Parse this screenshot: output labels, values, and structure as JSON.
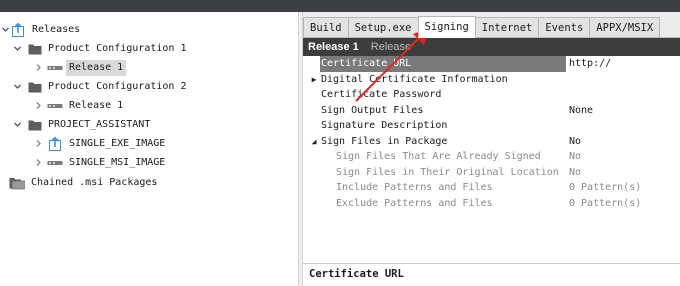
{
  "tree": {
    "root_label": "Releases",
    "items": [
      {
        "label": "Product Configuration 1"
      },
      {
        "label": "Release 1"
      },
      {
        "label": "Product Configuration 2"
      },
      {
        "label": "Release 1"
      },
      {
        "label": "PROJECT_ASSISTANT"
      },
      {
        "label": "SINGLE_EXE_IMAGE"
      },
      {
        "label": "SINGLE_MSI_IMAGE"
      },
      {
        "label": "Chained .msi Packages"
      }
    ]
  },
  "tabs": [
    {
      "label": "Build"
    },
    {
      "label": "Setup.exe"
    },
    {
      "label": "Signing"
    },
    {
      "label": "Internet"
    },
    {
      "label": "Events"
    },
    {
      "label": "APPX/MSIX"
    }
  ],
  "active_tab": "Signing",
  "header": {
    "title": "Release 1",
    "subtitle": "Release"
  },
  "properties": [
    {
      "name": "Certificate URL",
      "value": "http://"
    },
    {
      "name": "Digital Certificate Information",
      "value": ""
    },
    {
      "name": "Certificate Password",
      "value": ""
    },
    {
      "name": "Sign Output Files",
      "value": "None"
    },
    {
      "name": "Signature Description",
      "value": ""
    },
    {
      "name": "Sign Files in Package",
      "value": "No"
    },
    {
      "name": "Sign Files That Are Already Signed",
      "value": "No"
    },
    {
      "name": "Sign Files in Their Original Location",
      "value": "No"
    },
    {
      "name": "Include Patterns and Files",
      "value": "0 Pattern(s)"
    },
    {
      "name": "Exclude Patterns and Files",
      "value": "0 Pattern(s)"
    }
  ],
  "description": {
    "title": "Certificate URL"
  },
  "colors": {
    "annotation_arrow": "#e8231b",
    "header_bar": "#3c3c3c",
    "selected_row": "#7a7a7a",
    "tree_selection": "#d9d9d9",
    "release_icon_blue": "#3b8fd8"
  },
  "icons": {
    "expand": "chevron-right-icon",
    "collapse": "chevron-down-icon",
    "folder": "folder-icon",
    "release": "release-icon",
    "build": "upload-arrow-icon"
  }
}
